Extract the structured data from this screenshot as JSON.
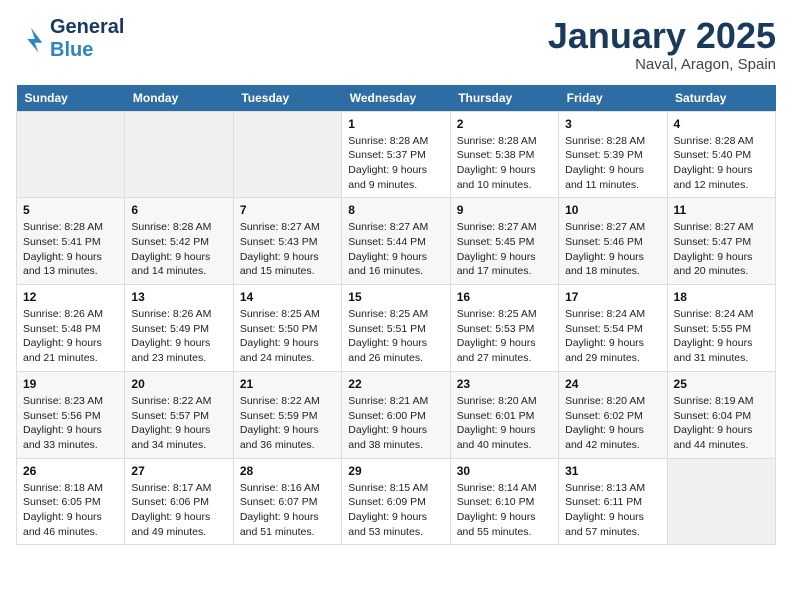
{
  "logo": {
    "line1": "General",
    "line2": "Blue"
  },
  "title": "January 2025",
  "location": "Naval, Aragon, Spain",
  "days_header": [
    "Sunday",
    "Monday",
    "Tuesday",
    "Wednesday",
    "Thursday",
    "Friday",
    "Saturday"
  ],
  "weeks": [
    [
      {
        "day": "",
        "info": ""
      },
      {
        "day": "",
        "info": ""
      },
      {
        "day": "",
        "info": ""
      },
      {
        "day": "1",
        "info": "Sunrise: 8:28 AM\nSunset: 5:37 PM\nDaylight: 9 hours and 9 minutes."
      },
      {
        "day": "2",
        "info": "Sunrise: 8:28 AM\nSunset: 5:38 PM\nDaylight: 9 hours and 10 minutes."
      },
      {
        "day": "3",
        "info": "Sunrise: 8:28 AM\nSunset: 5:39 PM\nDaylight: 9 hours and 11 minutes."
      },
      {
        "day": "4",
        "info": "Sunrise: 8:28 AM\nSunset: 5:40 PM\nDaylight: 9 hours and 12 minutes."
      }
    ],
    [
      {
        "day": "5",
        "info": "Sunrise: 8:28 AM\nSunset: 5:41 PM\nDaylight: 9 hours and 13 minutes."
      },
      {
        "day": "6",
        "info": "Sunrise: 8:28 AM\nSunset: 5:42 PM\nDaylight: 9 hours and 14 minutes."
      },
      {
        "day": "7",
        "info": "Sunrise: 8:27 AM\nSunset: 5:43 PM\nDaylight: 9 hours and 15 minutes."
      },
      {
        "day": "8",
        "info": "Sunrise: 8:27 AM\nSunset: 5:44 PM\nDaylight: 9 hours and 16 minutes."
      },
      {
        "day": "9",
        "info": "Sunrise: 8:27 AM\nSunset: 5:45 PM\nDaylight: 9 hours and 17 minutes."
      },
      {
        "day": "10",
        "info": "Sunrise: 8:27 AM\nSunset: 5:46 PM\nDaylight: 9 hours and 18 minutes."
      },
      {
        "day": "11",
        "info": "Sunrise: 8:27 AM\nSunset: 5:47 PM\nDaylight: 9 hours and 20 minutes."
      }
    ],
    [
      {
        "day": "12",
        "info": "Sunrise: 8:26 AM\nSunset: 5:48 PM\nDaylight: 9 hours and 21 minutes."
      },
      {
        "day": "13",
        "info": "Sunrise: 8:26 AM\nSunset: 5:49 PM\nDaylight: 9 hours and 23 minutes."
      },
      {
        "day": "14",
        "info": "Sunrise: 8:25 AM\nSunset: 5:50 PM\nDaylight: 9 hours and 24 minutes."
      },
      {
        "day": "15",
        "info": "Sunrise: 8:25 AM\nSunset: 5:51 PM\nDaylight: 9 hours and 26 minutes."
      },
      {
        "day": "16",
        "info": "Sunrise: 8:25 AM\nSunset: 5:53 PM\nDaylight: 9 hours and 27 minutes."
      },
      {
        "day": "17",
        "info": "Sunrise: 8:24 AM\nSunset: 5:54 PM\nDaylight: 9 hours and 29 minutes."
      },
      {
        "day": "18",
        "info": "Sunrise: 8:24 AM\nSunset: 5:55 PM\nDaylight: 9 hours and 31 minutes."
      }
    ],
    [
      {
        "day": "19",
        "info": "Sunrise: 8:23 AM\nSunset: 5:56 PM\nDaylight: 9 hours and 33 minutes."
      },
      {
        "day": "20",
        "info": "Sunrise: 8:22 AM\nSunset: 5:57 PM\nDaylight: 9 hours and 34 minutes."
      },
      {
        "day": "21",
        "info": "Sunrise: 8:22 AM\nSunset: 5:59 PM\nDaylight: 9 hours and 36 minutes."
      },
      {
        "day": "22",
        "info": "Sunrise: 8:21 AM\nSunset: 6:00 PM\nDaylight: 9 hours and 38 minutes."
      },
      {
        "day": "23",
        "info": "Sunrise: 8:20 AM\nSunset: 6:01 PM\nDaylight: 9 hours and 40 minutes."
      },
      {
        "day": "24",
        "info": "Sunrise: 8:20 AM\nSunset: 6:02 PM\nDaylight: 9 hours and 42 minutes."
      },
      {
        "day": "25",
        "info": "Sunrise: 8:19 AM\nSunset: 6:04 PM\nDaylight: 9 hours and 44 minutes."
      }
    ],
    [
      {
        "day": "26",
        "info": "Sunrise: 8:18 AM\nSunset: 6:05 PM\nDaylight: 9 hours and 46 minutes."
      },
      {
        "day": "27",
        "info": "Sunrise: 8:17 AM\nSunset: 6:06 PM\nDaylight: 9 hours and 49 minutes."
      },
      {
        "day": "28",
        "info": "Sunrise: 8:16 AM\nSunset: 6:07 PM\nDaylight: 9 hours and 51 minutes."
      },
      {
        "day": "29",
        "info": "Sunrise: 8:15 AM\nSunset: 6:09 PM\nDaylight: 9 hours and 53 minutes."
      },
      {
        "day": "30",
        "info": "Sunrise: 8:14 AM\nSunset: 6:10 PM\nDaylight: 9 hours and 55 minutes."
      },
      {
        "day": "31",
        "info": "Sunrise: 8:13 AM\nSunset: 6:11 PM\nDaylight: 9 hours and 57 minutes."
      },
      {
        "day": "",
        "info": ""
      }
    ]
  ]
}
